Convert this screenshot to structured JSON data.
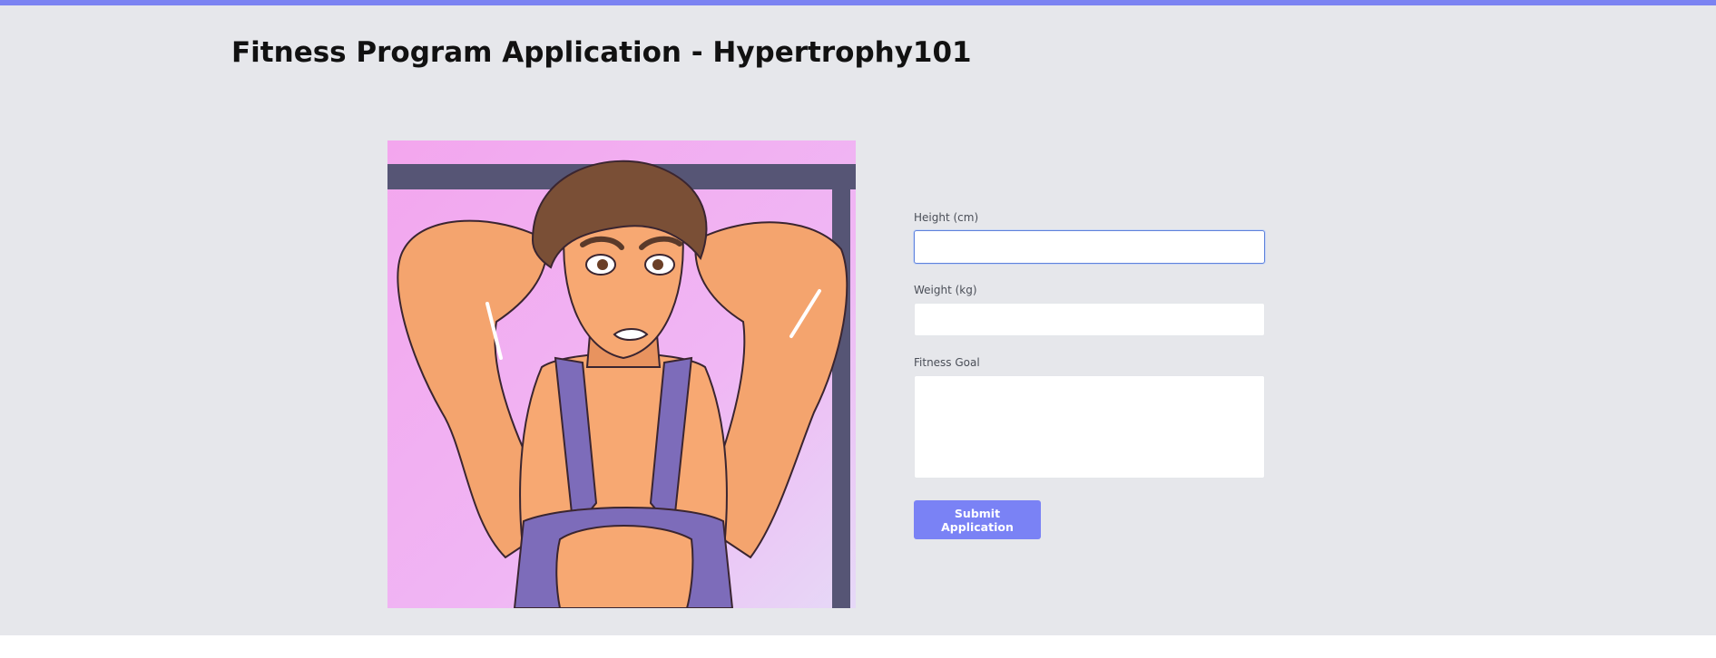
{
  "page": {
    "title": "Fitness Program Application - Hypertrophy101",
    "accent_color": "#7b83f2",
    "background_color": "#e6e7eb"
  },
  "illustration": {
    "alt": "Anime-style muscular man in a purple tank top with arms behind his head",
    "icon": "illustration"
  },
  "form": {
    "height": {
      "label": "Height (cm)",
      "value": "",
      "placeholder": ""
    },
    "weight": {
      "label": "Weight (kg)",
      "value": "",
      "placeholder": ""
    },
    "goal": {
      "label": "Fitness Goal",
      "value": "",
      "placeholder": ""
    },
    "submit_label": "Submit Application",
    "submit_color": "#7a82f5"
  }
}
